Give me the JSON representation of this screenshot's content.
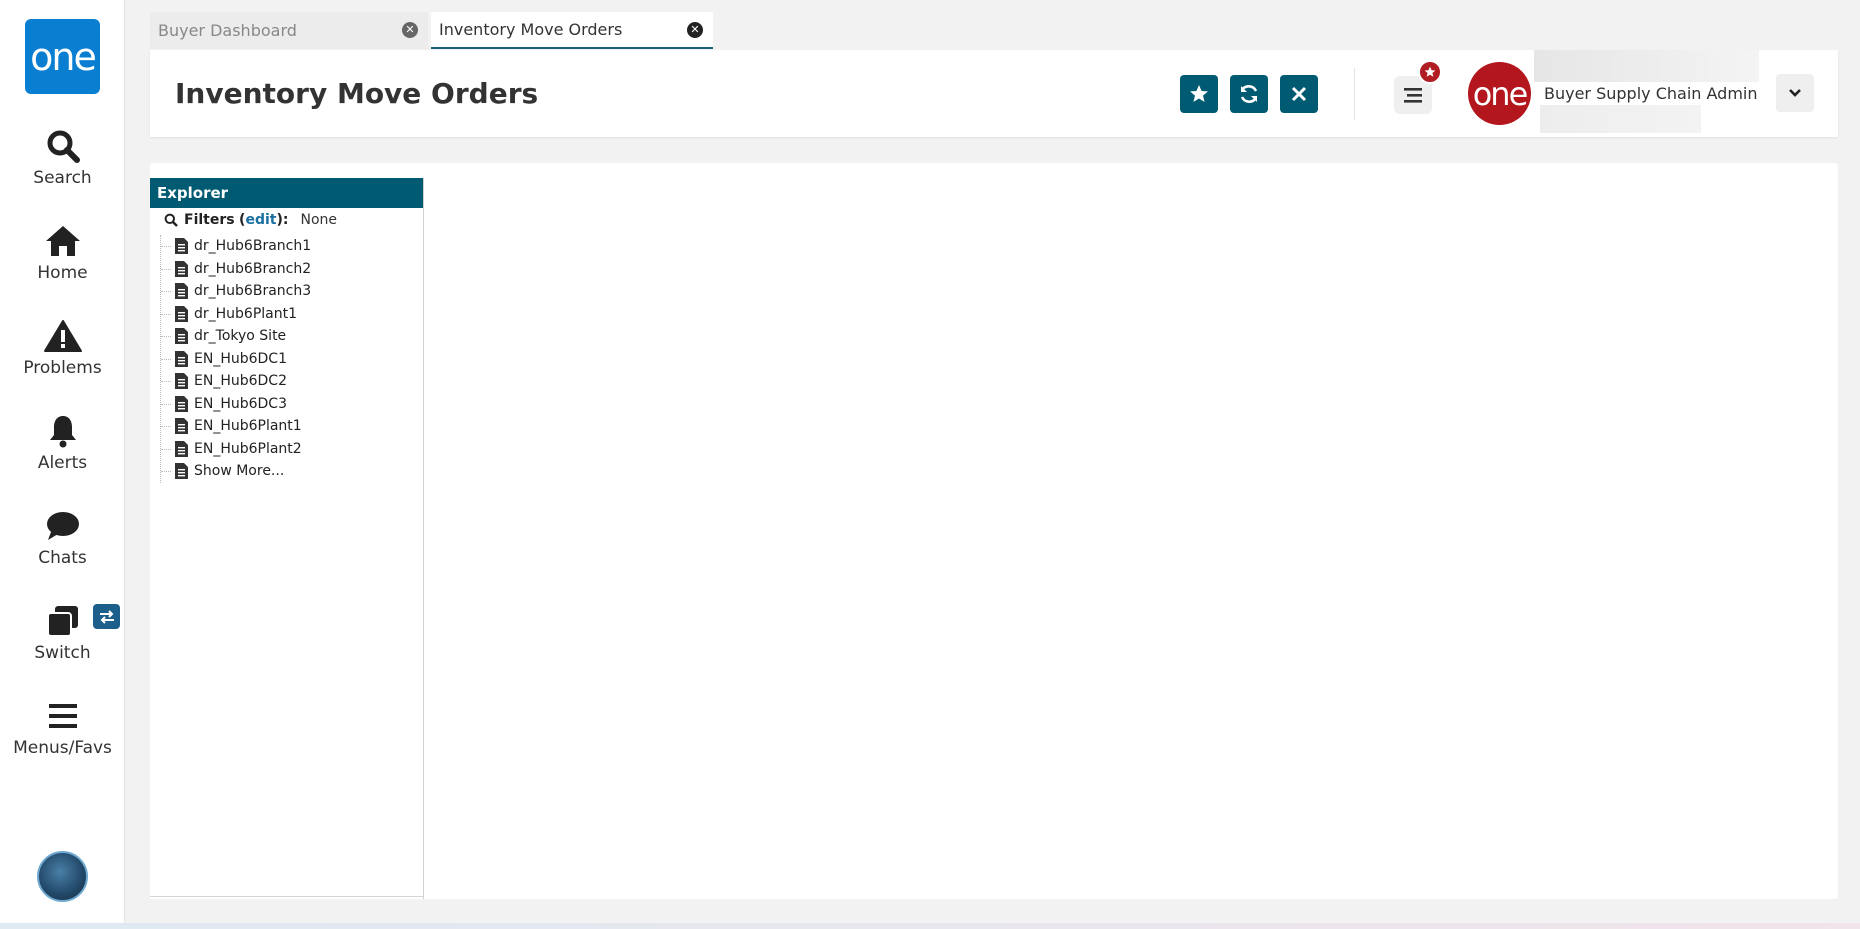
{
  "nav": {
    "logo_text": "one",
    "items": [
      {
        "label": "Search",
        "icon": "search-icon"
      },
      {
        "label": "Home",
        "icon": "home-icon"
      },
      {
        "label": "Problems",
        "icon": "warning-icon"
      },
      {
        "label": "Alerts",
        "icon": "bell-icon"
      },
      {
        "label": "Chats",
        "icon": "chat-icon"
      },
      {
        "label": "Switch",
        "icon": "switch-icon"
      },
      {
        "label": "Menus/Favs",
        "icon": "hamburger-icon"
      }
    ]
  },
  "tabs": [
    {
      "label": "Buyer Dashboard",
      "active": false
    },
    {
      "label": "Inventory Move Orders",
      "active": true
    }
  ],
  "header": {
    "title": "Inventory Move Orders",
    "user_logo_text": "one",
    "user_role": "Buyer Supply Chain Admin"
  },
  "explorer": {
    "title": "Explorer",
    "filters_label": "Filters",
    "edit_label": "edit",
    "filters_value": "None",
    "items": [
      "dr_Hub6Branch1",
      "dr_Hub6Branch2",
      "dr_Hub6Branch3",
      "dr_Hub6Plant1",
      "dr_Tokyo Site",
      "EN_Hub6DC1",
      "EN_Hub6DC2",
      "EN_Hub6DC3",
      "EN_Hub6Plant1",
      "EN_Hub6Plant2",
      "Show More..."
    ]
  },
  "colors": {
    "brand_blue": "#0a7fd1",
    "header_teal": "#005a72",
    "user_red": "#b3161d"
  }
}
